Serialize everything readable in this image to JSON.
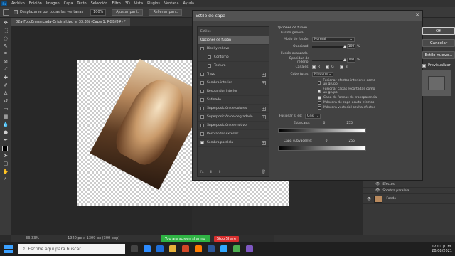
{
  "menubar": {
    "logo": "Ps",
    "items": [
      "Archivo",
      "Edición",
      "Imagen",
      "Capa",
      "Texto",
      "Selección",
      "Filtro",
      "3D",
      "Vista",
      "Plugins",
      "Ventana",
      "Ayuda"
    ]
  },
  "options": {
    "scroll_all": "Desplazarse por todas las ventanas",
    "zoom": "100%",
    "fit": "Ajustar pant.",
    "fill": "Rellenar pant."
  },
  "document": {
    "tab": "02a-FotoEnmarcada-Original.jpg al 33.3% (Capa 1, RGB/8#) *"
  },
  "status": {
    "zoom": "33.33%",
    "size": "1920 px x 1309 px (300 ppp)"
  },
  "dialog": {
    "title": "Estilo de capa",
    "close": "✕",
    "styles_head": "Estilos",
    "styles": [
      {
        "label": "Opciones de fusión",
        "checkbox": false,
        "selected": true,
        "plus": false,
        "indent": false
      },
      {
        "label": "Bisel y relieve",
        "checkbox": true,
        "on": false,
        "plus": false,
        "indent": false
      },
      {
        "label": "Contorno",
        "checkbox": true,
        "on": false,
        "plus": false,
        "indent": true
      },
      {
        "label": "Textura",
        "checkbox": true,
        "on": false,
        "plus": false,
        "indent": true
      },
      {
        "label": "Trazo",
        "checkbox": true,
        "on": false,
        "plus": true,
        "indent": false
      },
      {
        "label": "Sombra interior",
        "checkbox": true,
        "on": false,
        "plus": true,
        "indent": false
      },
      {
        "label": "Resplandor interior",
        "checkbox": true,
        "on": false,
        "plus": false,
        "indent": false
      },
      {
        "label": "Satinado",
        "checkbox": true,
        "on": false,
        "plus": false,
        "indent": false
      },
      {
        "label": "Superposición de colores",
        "checkbox": true,
        "on": false,
        "plus": true,
        "indent": false
      },
      {
        "label": "Superposición de degradado",
        "checkbox": true,
        "on": false,
        "plus": true,
        "indent": false
      },
      {
        "label": "Superposición de motivo",
        "checkbox": true,
        "on": false,
        "plus": false,
        "indent": false
      },
      {
        "label": "Resplandor exterior",
        "checkbox": true,
        "on": false,
        "plus": false,
        "indent": false
      },
      {
        "label": "Sombra paralela",
        "checkbox": true,
        "on": true,
        "plus": true,
        "indent": false
      }
    ],
    "footer_fx": "fx",
    "opts": {
      "section": "Opciones de fusión",
      "general": "Fusión general",
      "mode_label": "Modo de fusión:",
      "mode_value": "Normal",
      "opacity_label": "Opacidad:",
      "opacity_value": "100",
      "opacity_fraction": 1.0,
      "advanced": "Fusión avanzada",
      "fill_label": "Opacidad de relleno:",
      "fill_value": "100",
      "fill_fraction": 1.0,
      "channels_label": "Canales:",
      "channels": [
        "R",
        "G",
        "B"
      ],
      "knockout_label": "Coberturas:",
      "knockout_value": "Ninguna",
      "checks": [
        {
          "label": "Fusionar efectos interiores como un grupo",
          "on": false
        },
        {
          "label": "Fusionar capas recortadas como un grupo",
          "on": true
        },
        {
          "label": "Capa de formas de transparencia",
          "on": true
        },
        {
          "label": "Máscara de capa oculta efectos",
          "on": false
        },
        {
          "label": "Máscara vectorial oculta efectos",
          "on": false
        }
      ],
      "blendif_label": "Fusionar si es:",
      "blendif_value": "Gris",
      "this_layer": "Esta capa:",
      "underlying": "Capa subyacente:",
      "range_min": "0",
      "range_max": "255",
      "percent": "%"
    },
    "buttons": {
      "ok": "OK",
      "cancel": "Cancelar",
      "new_style": "Estilo nuevo...",
      "preview": "Previsualizar"
    }
  },
  "layers": {
    "items": [
      {
        "name": "Capa 1",
        "sub": false
      },
      {
        "name": "Efectos",
        "sub": true
      },
      {
        "name": "Sombra paralela",
        "sub": true
      },
      {
        "name": "Fondo",
        "sub": false
      }
    ]
  },
  "share": {
    "notice": "You are screen sharing",
    "stop": "Stop Share"
  },
  "taskbar": {
    "search": "Escribe aquí para buscar",
    "time": "12:01 p. m.",
    "date": "20/08/2021"
  },
  "colors": {
    "accent": "#31a8ff",
    "share_green": "#2fb344",
    "share_red": "#d9302f"
  }
}
